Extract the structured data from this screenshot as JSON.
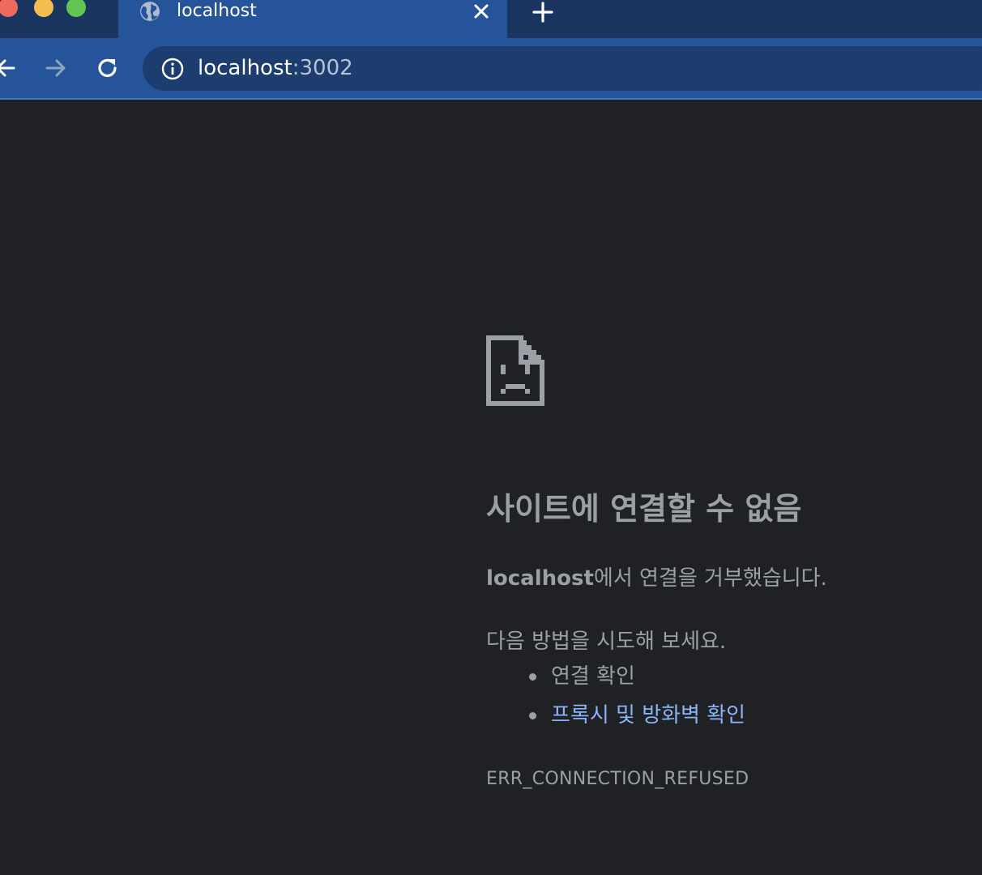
{
  "browser": {
    "tab": {
      "title": "localhost",
      "favicon": "globe-icon",
      "close_icon": "close-icon"
    },
    "new_tab_icon": "plus-icon",
    "nav": {
      "back_icon": "arrow-left-icon",
      "forward_icon": "arrow-right-icon",
      "reload_icon": "reload-icon"
    },
    "address_bar": {
      "icon": "info-icon",
      "host": "localhost",
      "port": ":3002"
    },
    "colors": {
      "tabstrip": "#1a3560",
      "active_tab": "#26549a",
      "omnibox": "#1d3d6e",
      "page_bg": "#202124",
      "link": "#8ab4f8"
    }
  },
  "error_page": {
    "icon": "sad-document-icon",
    "title": "사이트에 연결할 수 없음",
    "description_host": "localhost",
    "description_rest": "에서 연결을 거부했습니다.",
    "try_heading": "다음 방법을 시도해 보세요.",
    "suggestions": [
      {
        "text": "연결 확인",
        "is_link": false
      },
      {
        "text": "프록시 및 방화벽 확인",
        "is_link": true
      }
    ],
    "error_code": "ERR_CONNECTION_REFUSED"
  }
}
